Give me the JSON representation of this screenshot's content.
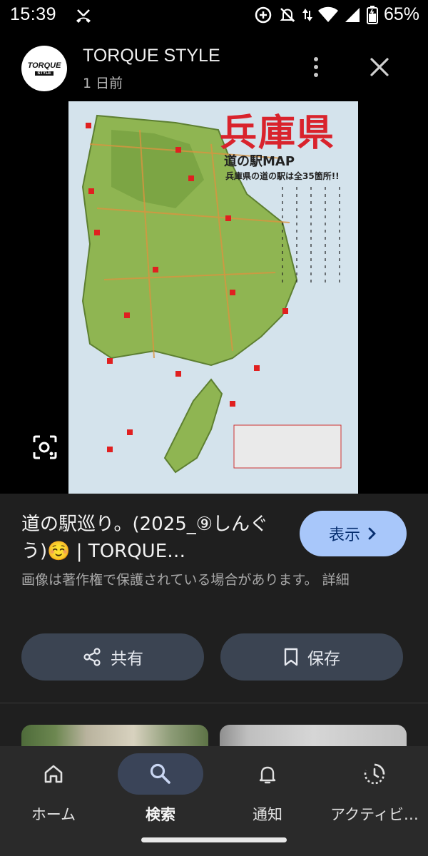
{
  "status_bar": {
    "time": "15:39",
    "battery_percent": "65%"
  },
  "header": {
    "channel_name": "TORQUE STYLE",
    "logo_text_top": "TORQUE",
    "logo_text_bottom": "STYLE",
    "timestamp": "1 日前"
  },
  "image": {
    "map_title": "兵庫県",
    "map_subtitle": "道の駅MAP",
    "map_note": "兵庫県の道の駅は全35箇所!!"
  },
  "result": {
    "title": "道の駅巡り。(2025_⑨しんぐう)☺️ | TORQUE…",
    "view_button": "表示",
    "copyright_notice": "画像は著作権で保護されている場合があります。 詳細"
  },
  "actions": {
    "share_label": "共有",
    "save_label": "保存"
  },
  "bottom_nav": {
    "items": [
      {
        "label": "ホーム",
        "icon": "home-icon"
      },
      {
        "label": "検索",
        "icon": "search-icon"
      },
      {
        "label": "通知",
        "icon": "bell-icon"
      },
      {
        "label": "アクティビ…",
        "icon": "activity-icon"
      }
    ],
    "active_index": 1
  },
  "colors": {
    "accent_button": "#a8c7fa",
    "map_title_red": "#d9232c",
    "pill_button": "#3b4452"
  }
}
